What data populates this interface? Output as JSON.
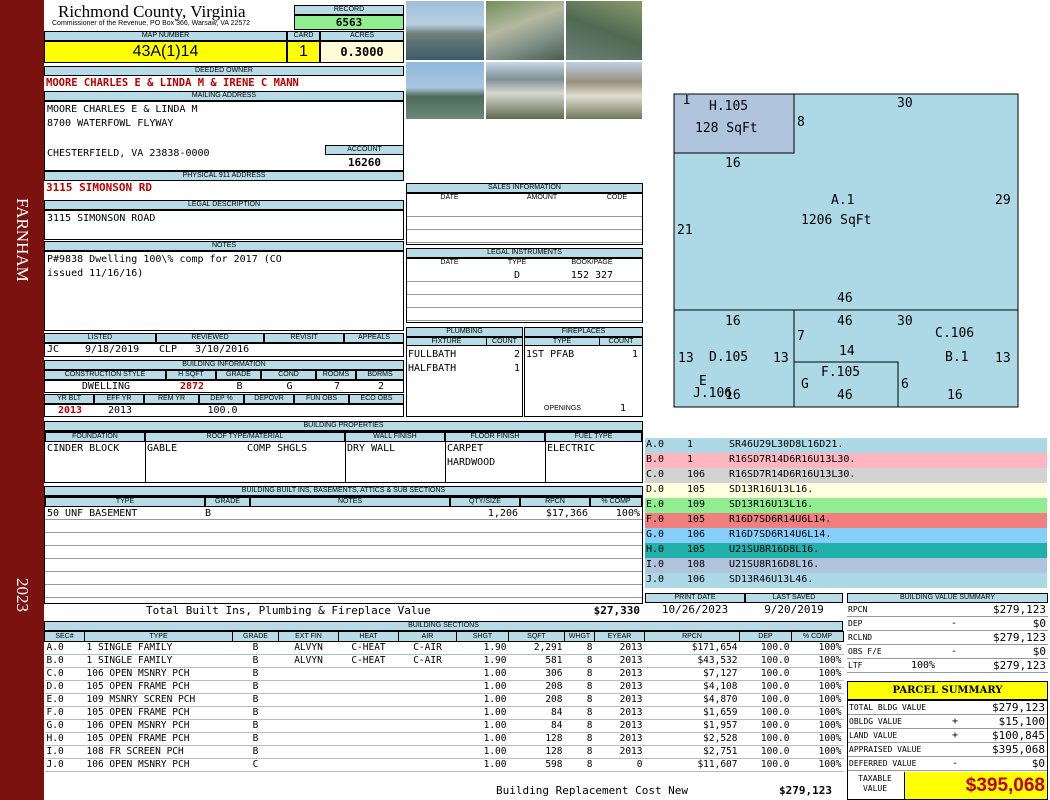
{
  "sidebar": {
    "place": "FARNHAM",
    "year": "2023",
    "color": "#7a1210"
  },
  "header": {
    "county": "Richmond County, Virginia",
    "commissioner": "Commissioner of the Revenue, PO Box 366, Warsaw, VA 22572",
    "record_label": "RECORD",
    "record": "6563",
    "map_label": "MAP NUMBER",
    "map_number": "43A(1)14",
    "card_label": "CARD",
    "card": "1",
    "acres_label": "ACRES",
    "acres": "0.3000"
  },
  "owner": {
    "label": "DEEDED OWNER",
    "name": "MOORE CHARLES E & LINDA M & IRENE C MANN",
    "mail_label": "MAILING ADDRESS",
    "mail_line1": "MOORE CHARLES E & LINDA M",
    "mail_line2": "8700 WATERFOWL FLYWAY",
    "mail_line3": "CHESTERFIELD, VA 23838-0000",
    "account_label": "ACCOUNT",
    "account": "16260"
  },
  "address": {
    "label": "PHYSICAL 911 ADDRESS",
    "value": "3115 SIMONSON RD"
  },
  "legal": {
    "label": "LEGAL DESCRIPTION",
    "value": "3115 SIMONSON ROAD"
  },
  "notes": {
    "label": "NOTES",
    "line1": "P#9838 Dwelling 100\\% comp for 2017 (CO",
    "line2": "issued 11/16/16)"
  },
  "review": {
    "listed_label": "LISTED",
    "reviewed_label": "REVIEWED",
    "revisit_label": "REVISIT",
    "appeals_label": "APPEALS",
    "listed_by": "JC",
    "listed_date": "9/18/2019",
    "reviewed_by": "CLP",
    "reviewed_date": "3/10/2016"
  },
  "building_info": {
    "label": "BUILDING INFORMATION",
    "h_style": "CONSTRUCTION STYLE",
    "h_sqft": "H SQFT",
    "h_grade": "GRADE",
    "h_cond": "COND",
    "h_rooms": "ROOMS",
    "h_bdrms": "BDRMS",
    "style": "DWELLING",
    "sqft": "2872",
    "grade": "B",
    "cond": "G",
    "rooms": "7",
    "bdrms": "2",
    "h_yrblt": "YR BLT",
    "h_effyr": "EFF YR",
    "h_remyr": "REM YR",
    "h_dep": "DEP %",
    "h_depovr": "DEPOVR",
    "h_funobs": "FUN OBS",
    "h_ecoobs": "ECO OBS",
    "yrblt": "2013",
    "effyr": "2013",
    "dep": "100.0"
  },
  "sales": {
    "label": "SALES INFORMATION",
    "h_date": "DATE",
    "h_amount": "AMOUNT",
    "h_code": "CODE"
  },
  "instruments": {
    "label": "LEGAL INSTRUMENTS",
    "h_date": "DATE",
    "h_type": "TYPE",
    "h_book": "BOOK/PAGE",
    "type": "D",
    "book": "152 327"
  },
  "plumbing": {
    "label": "PLUMBING",
    "h_fixture": "FIXTURE",
    "h_count": "COUNT",
    "rows": [
      {
        "fixture": "FULLBATH",
        "count": "2"
      },
      {
        "fixture": "HALFBATH",
        "count": "1"
      }
    ]
  },
  "fireplaces": {
    "label": "FIREPLACES",
    "h_type": "TYPE",
    "h_count": "COUNT",
    "type": "1ST PFAB",
    "count": "1",
    "openings_label": "OPENINGS",
    "openings": "1"
  },
  "properties": {
    "label": "BUILDING PROPERTIES",
    "h_found": "FOUNDATION",
    "h_roof": "ROOF TYPE/MATERIAL",
    "h_wall": "WALL FINISH",
    "h_floor": "FLOOR FINISH",
    "h_fuel": "FUEL TYPE",
    "foundation": "CINDER BLOCK",
    "roof_type": "GABLE",
    "roof_mat": "COMP SHGLS",
    "wall": "DRY WALL",
    "floor1": "CARPET",
    "floor2": "HARDWOOD",
    "fuel": "ELECTRIC"
  },
  "builtins": {
    "label": "BUILDING BUILT INS, BASEMENTS, ATTICS & SUB SECTIONS",
    "h_type": "TYPE",
    "h_grade": "GRADE",
    "h_notes": "NOTES",
    "h_qty": "QTY/SIZE",
    "h_rpcn": "RPCN",
    "h_comp": "% COMP",
    "type": "50 UNF BASEMENT",
    "grade": "B",
    "qty": "1,206",
    "rpcn": "$17,366",
    "comp": "100%",
    "total_label": "Total Built Ins, Plumbing & Fireplace Value",
    "total": "$27,330"
  },
  "sketch": {
    "areas": [
      {
        "code": "I",
        "label": "H.105",
        "sqft": "128 SqFt"
      },
      {
        "label": "A.1",
        "sqft": "1206 SqFt"
      },
      {
        "label": "D.105"
      },
      {
        "label": "E"
      },
      {
        "label": "J.106"
      },
      {
        "label": "G"
      },
      {
        "label": "F.105"
      },
      {
        "label": "C.106"
      },
      {
        "label": "B.1"
      }
    ],
    "dims": [
      "30",
      "8",
      "16",
      "29",
      "21",
      "46",
      "16",
      "46",
      "30",
      "7",
      "13",
      "13",
      "14",
      "13",
      "6",
      "46",
      "16",
      "16"
    ]
  },
  "vectors": [
    {
      "code": "A.0",
      "n": "1",
      "v": "SR46U29L30D8L16D21.",
      "color": "#add8e6"
    },
    {
      "code": "B.0",
      "n": "1",
      "v": "R16SD7R14D6R16U13L30.",
      "color": "#ffb6c1"
    },
    {
      "code": "C.0",
      "n": "106",
      "v": "R16SD7R14D6R16U13L30.",
      "color": "#d3d3d3"
    },
    {
      "code": "D.0",
      "n": "105",
      "v": "SD13R16U13L16.",
      "color": "#ffffe0"
    },
    {
      "code": "E.0",
      "n": "109",
      "v": "SD13R16U13L16.",
      "color": "#90ee90"
    },
    {
      "code": "F.0",
      "n": "105",
      "v": "R16D7SD6R14U6L14.",
      "color": "#f08080"
    },
    {
      "code": "G.0",
      "n": "106",
      "v": "R16D7SD6R14U6L14.",
      "color": "#87cefa"
    },
    {
      "code": "H.0",
      "n": "105",
      "v": "U21SU8R16D8L16.",
      "color": "#20b2aa"
    },
    {
      "code": "I.0",
      "n": "108",
      "v": "U21SU8R16D8L16.",
      "color": "#b0c4de"
    },
    {
      "code": "J.0",
      "n": "106",
      "v": "SD13R46U13L46.",
      "color": "#add8e6"
    }
  ],
  "print": {
    "print_label": "PRINT DATE",
    "saved_label": "LAST SAVED",
    "print_date": "10/26/2023",
    "saved_date": "9/20/2019"
  },
  "value_summary": {
    "label": "BUILDING VALUE SUMMARY",
    "rows": [
      {
        "k": "RPCN",
        "s": "",
        "v": "$279,123"
      },
      {
        "k": "DEP",
        "s": "-",
        "v": "$0"
      },
      {
        "k": "RCLND",
        "s": "",
        "v": "$279,123"
      },
      {
        "k": "OBS F/E",
        "s": "-",
        "v": "$0"
      },
      {
        "k": "LTF",
        "p": "100%",
        "s": "",
        "v": "$279,123"
      }
    ]
  },
  "parcel": {
    "label": "PARCEL SUMMARY",
    "rows": [
      {
        "k": "TOTAL BLDG VALUE",
        "s": "",
        "v": "$279,123"
      },
      {
        "k": "OBLDG VALUE",
        "s": "+",
        "v": "$15,100"
      },
      {
        "k": "LAND VALUE",
        "s": "+",
        "v": "$100,845"
      },
      {
        "k": "APPRAISED VALUE",
        "s": "",
        "v": "$395,068"
      },
      {
        "k": "DEFERRED VALUE",
        "s": "-",
        "v": "$0"
      }
    ],
    "taxable_label": "TAXABLE VALUE",
    "taxable": "$395,068"
  },
  "sections": {
    "label": "BUILDING SECTIONS",
    "headers": [
      "SEC#",
      "TYPE",
      "GRADE",
      "EXT FIN",
      "HEAT",
      "AIR",
      "SHGT",
      "SQFT",
      "WHGT",
      "EYEAR",
      "RPCN",
      "DEP",
      "% COMP"
    ],
    "rows": [
      [
        "A.0",
        "1 SINGLE FAMILY",
        "B",
        "ALVYN",
        "C-HEAT",
        "C-AIR",
        "1.90",
        "2,291",
        "8",
        "2013",
        "$171,654",
        "100.0",
        "100%"
      ],
      [
        "B.0",
        "1 SINGLE FAMILY",
        "B",
        "ALVYN",
        "C-HEAT",
        "C-AIR",
        "1.90",
        "581",
        "8",
        "2013",
        "$43,532",
        "100.0",
        "100%"
      ],
      [
        "C.0",
        "106 OPEN MSNRY PCH",
        "B",
        "",
        "",
        "",
        "1.00",
        "306",
        "8",
        "2013",
        "$7,127",
        "100.0",
        "100%"
      ],
      [
        "D.0",
        "105 OPEN FRAME PCH",
        "B",
        "",
        "",
        "",
        "1.00",
        "208",
        "8",
        "2013",
        "$4,108",
        "100.0",
        "100%"
      ],
      [
        "E.0",
        "109 MSNRY SCREN PCH",
        "B",
        "",
        "",
        "",
        "1.00",
        "208",
        "8",
        "2013",
        "$4,870",
        "100.0",
        "100%"
      ],
      [
        "F.0",
        "105 OPEN FRAME PCH",
        "B",
        "",
        "",
        "",
        "1.00",
        "84",
        "8",
        "2013",
        "$1,659",
        "100.0",
        "100%"
      ],
      [
        "G.0",
        "106 OPEN MSNRY PCH",
        "B",
        "",
        "",
        "",
        "1.00",
        "84",
        "8",
        "2013",
        "$1,957",
        "100.0",
        "100%"
      ],
      [
        "H.0",
        "105 OPEN FRAME PCH",
        "B",
        "",
        "",
        "",
        "1.00",
        "128",
        "8",
        "2013",
        "$2,528",
        "100.0",
        "100%"
      ],
      [
        "I.0",
        "108 FR SCREEN PCH",
        "B",
        "",
        "",
        "",
        "1.00",
        "128",
        "8",
        "2013",
        "$2,751",
        "100.0",
        "100%"
      ],
      [
        "J.0",
        "106 OPEN MSNRY PCH",
        "C",
        "",
        "",
        "",
        "1.00",
        "598",
        "8",
        "0",
        "$11,607",
        "100.0",
        "100%"
      ]
    ],
    "total_label": "Building Replacement Cost New",
    "total": "$279,123"
  }
}
